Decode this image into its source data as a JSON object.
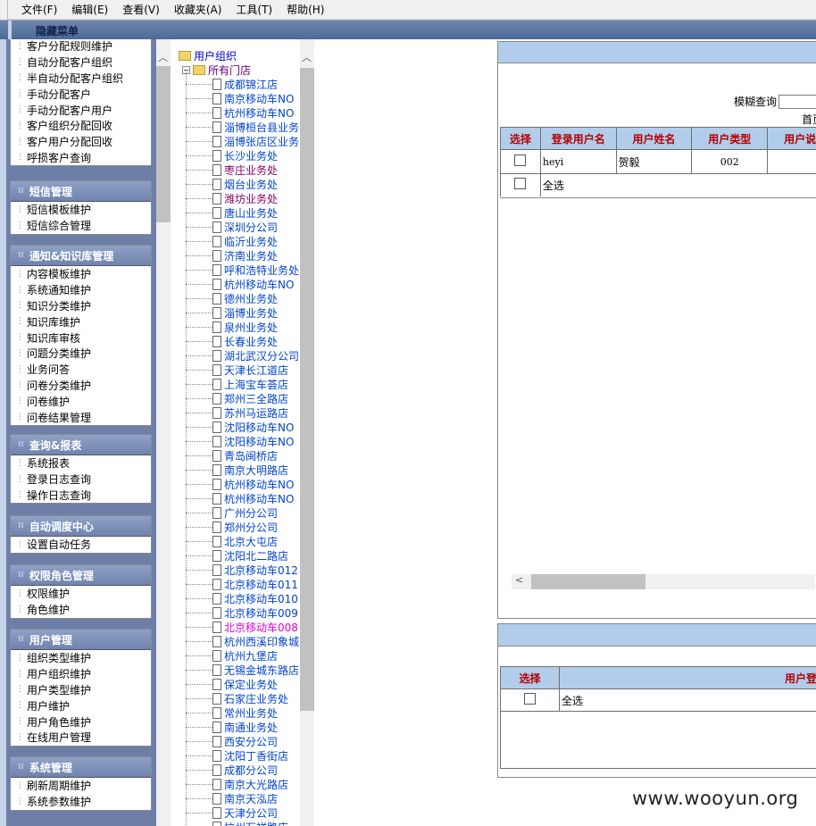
{
  "menubar": [
    "文件(F)",
    "编辑(E)",
    "查看(V)",
    "收藏夹(A)",
    "工具(T)",
    "帮助(H)"
  ],
  "hidden_menu_label": "隐藏菜单",
  "menu_groups": [
    {
      "title": "",
      "items": [
        "客户分配规则维护",
        "自动分配客户组织",
        "半自动分配客户组织",
        "手动分配客户",
        "手动分配客户用户",
        "客户组织分配回收",
        "客户用户分配回收",
        "呼损客户查询"
      ]
    },
    {
      "title": "短信管理",
      "items": [
        "短信模板维护",
        "短信综合管理"
      ]
    },
    {
      "title": "通知&知识库管理",
      "items": [
        "内容模板维护",
        "系统通知维护",
        "知识分类维护",
        "知识库维护",
        "知识库审核",
        "问题分类维护",
        "业务问答",
        "问卷分类维护",
        "问卷维护",
        "问卷结果管理"
      ]
    },
    {
      "title": "查询&报表",
      "items": [
        "系统报表",
        "登录日志查询",
        "操作日志查询"
      ]
    },
    {
      "title": "自动调度中心",
      "items": [
        "设置自动任务"
      ]
    },
    {
      "title": "权限角色管理",
      "items": [
        "权限维护",
        "角色维护"
      ]
    },
    {
      "title": "用户管理",
      "items": [
        "组织类型维护",
        "用户组织维护",
        "用户类型维护",
        "用户维护",
        "用户角色维护",
        "在线用户管理"
      ]
    },
    {
      "title": "系统管理",
      "items": [
        "刷新周期维护",
        "系统参数维护"
      ]
    }
  ],
  "tree": {
    "root": "用户组织",
    "sub": "所有门店",
    "nodes": [
      {
        "label": "成都锦江店"
      },
      {
        "label": "南京移动车NO"
      },
      {
        "label": "杭州移动车NO"
      },
      {
        "label": "淄博桓台县业务"
      },
      {
        "label": "淄博张店区业务"
      },
      {
        "label": "长沙业务处"
      },
      {
        "label": "枣庄业务处",
        "visited": true
      },
      {
        "label": "烟台业务处"
      },
      {
        "label": "潍坊业务处",
        "visited": true
      },
      {
        "label": "唐山业务处"
      },
      {
        "label": "深圳分公司"
      },
      {
        "label": "临沂业务处"
      },
      {
        "label": "济南业务处"
      },
      {
        "label": "呼和浩特业务处"
      },
      {
        "label": "杭州移动车NO"
      },
      {
        "label": "德州业务处"
      },
      {
        "label": "淄博业务处"
      },
      {
        "label": "泉州业务处"
      },
      {
        "label": "长春业务处"
      },
      {
        "label": "湖北武汉分公司"
      },
      {
        "label": "天津长江道店"
      },
      {
        "label": "上海宝车荟店"
      },
      {
        "label": "郑州三全路店"
      },
      {
        "label": "苏州马运路店"
      },
      {
        "label": "沈阳移动车NO"
      },
      {
        "label": "沈阳移动车NO"
      },
      {
        "label": "青岛闽桥店"
      },
      {
        "label": "南京大明路店"
      },
      {
        "label": "杭州移动车NO"
      },
      {
        "label": "杭州移动车NO"
      },
      {
        "label": "广州分公司"
      },
      {
        "label": "郑州分公司"
      },
      {
        "label": "北京大屯店"
      },
      {
        "label": "沈阳北二路店"
      },
      {
        "label": "北京移动车012"
      },
      {
        "label": "北京移动车011"
      },
      {
        "label": "北京移动车010"
      },
      {
        "label": "北京移动车009"
      },
      {
        "label": "北京移动车008",
        "active": true
      },
      {
        "label": "杭州西溪印象城"
      },
      {
        "label": "杭州九堡店"
      },
      {
        "label": "无锡金城东路店"
      },
      {
        "label": "保定业务处"
      },
      {
        "label": "石家庄业务处"
      },
      {
        "label": "常州业务处"
      },
      {
        "label": "南通业务处"
      },
      {
        "label": "西安分公司"
      },
      {
        "label": "沈阳丁香街店"
      },
      {
        "label": "成都分公司"
      },
      {
        "label": "南京大光路店"
      },
      {
        "label": "南京天泓店"
      },
      {
        "label": "天津分公司"
      },
      {
        "label": "杭州石祥路店"
      }
    ]
  },
  "panel1": {
    "fuzzy_label": "模糊查询",
    "fuzzy_value": "",
    "first_page": "首页",
    "headers": [
      "选择",
      "登录用户名",
      "用户姓名",
      "用户类型",
      "用户说"
    ],
    "rows": [
      {
        "login": "heyi",
        "name": "贺毅",
        "type": "002",
        "desc": ""
      }
    ],
    "select_all": "全选"
  },
  "panel2": {
    "headers": [
      "选择",
      "用户登录"
    ],
    "select_all": "全选"
  },
  "watermark": "www.wooyun.org"
}
